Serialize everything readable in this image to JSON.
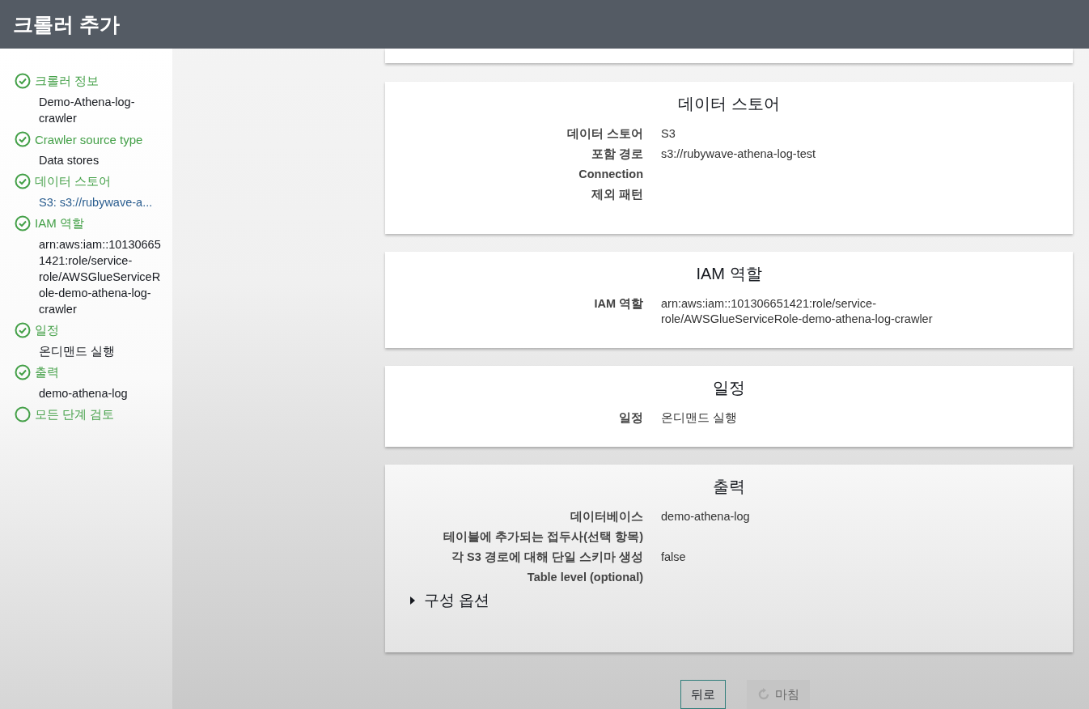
{
  "header": {
    "title": "크롤러 추가"
  },
  "steps": [
    {
      "label": "크롤러 정보",
      "done": true,
      "detail": {
        "kind": "text",
        "text": "Demo-Athena-log-crawler"
      }
    },
    {
      "label": "Crawler source type",
      "done": true,
      "detail": {
        "kind": "text",
        "text": "Data stores"
      }
    },
    {
      "label": "데이터 스토어",
      "done": true,
      "detail": {
        "kind": "link",
        "text": "S3: s3://rubywave-a..."
      }
    },
    {
      "label": "IAM 역할",
      "done": true,
      "detail": {
        "kind": "text",
        "text": "arn:aws:iam::101306651421:role/service-role/AWSGlueServiceRole-demo-athena-log-crawler"
      }
    },
    {
      "label": "일정",
      "done": true,
      "detail": {
        "kind": "text",
        "text": "온디맨드 실행"
      }
    },
    {
      "label": "출력",
      "done": true,
      "detail": {
        "kind": "text",
        "text": "demo-athena-log"
      }
    },
    {
      "label": "모든 단계 검토",
      "done": false
    }
  ],
  "sections": [
    {
      "title": "데이터 스토어",
      "rows": [
        {
          "label": "데이터 스토어",
          "value": "S3"
        },
        {
          "label": "포함 경로",
          "value": "s3://rubywave-athena-log-test"
        },
        {
          "label": "Connection"
        },
        {
          "label": "제외 패턴"
        }
      ]
    },
    {
      "title": "IAM 역할",
      "rows": [
        {
          "label": "IAM 역할",
          "value": "arn:aws:iam::101306651421:role/service-role/AWSGlueServiceRole-demo-athena-log-crawler"
        }
      ]
    },
    {
      "title": "일정",
      "rows": [
        {
          "label": "일정",
          "value": "온디맨드 실행"
        }
      ]
    },
    {
      "title": "출력",
      "rows": [
        {
          "label": "데이터베이스",
          "value": "demo-athena-log"
        },
        {
          "label": "테이블에 추가되는 접두사(선택 항목)"
        },
        {
          "label": "각 S3 경로에 대해 단일 스키마 생성",
          "value": "false"
        },
        {
          "label": "Table level (optional)"
        }
      ],
      "expander": {
        "label": "구성 옵션",
        "expanded": false
      }
    }
  ],
  "buttons": [
    {
      "label": "뒤로",
      "disabled": false
    },
    {
      "label": "마침",
      "disabled": true
    }
  ]
}
